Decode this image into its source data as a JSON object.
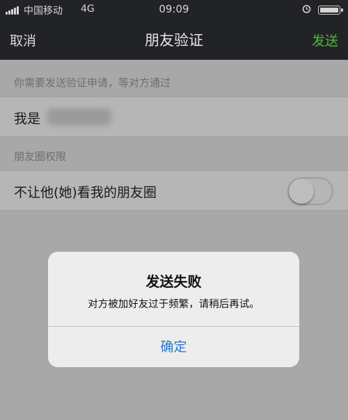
{
  "status_bar": {
    "carrier": "中国移动",
    "network": "4G",
    "time": "09:09",
    "icons": [
      "signal-bars-icon",
      "alarm-icon",
      "battery-icon"
    ]
  },
  "nav": {
    "cancel": "取消",
    "title": "朋友验证",
    "send": "发送",
    "send_color": "#4fb83a"
  },
  "request_section": {
    "label": "你需要发送验证申请，等对方通过",
    "message_prefix": "我是"
  },
  "moments_section": {
    "label": "朋友圈权限",
    "row_label": "不让他(她)看我的朋友圈",
    "toggle_on": false
  },
  "alert": {
    "title": "发送失败",
    "message": "对方被加好友过于频繁，请稍后再试。",
    "confirm": "确定",
    "confirm_color": "#2878d7"
  }
}
